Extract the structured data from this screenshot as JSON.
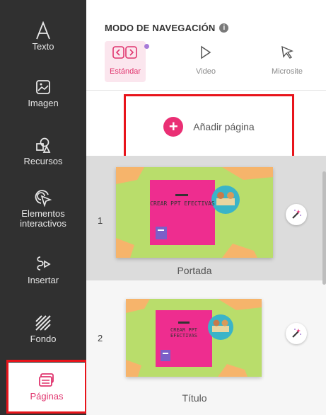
{
  "sidebar": {
    "items": [
      {
        "label": "Texto",
        "icon": "letter-a-icon"
      },
      {
        "label": "Imagen",
        "icon": "image-icon"
      },
      {
        "label": "Recursos",
        "icon": "shapes-icon"
      },
      {
        "label": "Elementos interactivos",
        "icon": "interactive-pointer-icon"
      },
      {
        "label": "Insertar",
        "icon": "insert-icon"
      },
      {
        "label": "Fondo",
        "icon": "background-stripes-icon"
      },
      {
        "label": "Páginas",
        "icon": "pages-stack-icon"
      }
    ],
    "active_item": "Páginas"
  },
  "navigation_mode": {
    "title": "MODO DE NAVEGACIÓN",
    "info_icon": "i",
    "modes": [
      {
        "label": "Estándar",
        "icon": "code-brackets-icon",
        "active": true
      },
      {
        "label": "Video",
        "icon": "play-triangle-icon",
        "active": false
      },
      {
        "label": "Microsite",
        "icon": "cursor-arrow-icon",
        "active": false
      }
    ]
  },
  "add_page": {
    "label": "Añadir página",
    "icon": "plus-icon"
  },
  "pages": [
    {
      "number": "1",
      "title": "Portada",
      "thumb_text": "CREAR PPT EFECTIVAS",
      "selected": true
    },
    {
      "number": "2",
      "title": "Título",
      "thumb_text": "CREAR PPT EFECTIVAS",
      "selected": false
    }
  ],
  "colors": {
    "sidebar_bg": "#303030",
    "accent": "#ea2f74",
    "highlight_border": "#e8141b",
    "thumb_green": "#b9dd6b",
    "thumb_pink": "#ee2d8f",
    "thumb_orange": "#f6b46b"
  }
}
